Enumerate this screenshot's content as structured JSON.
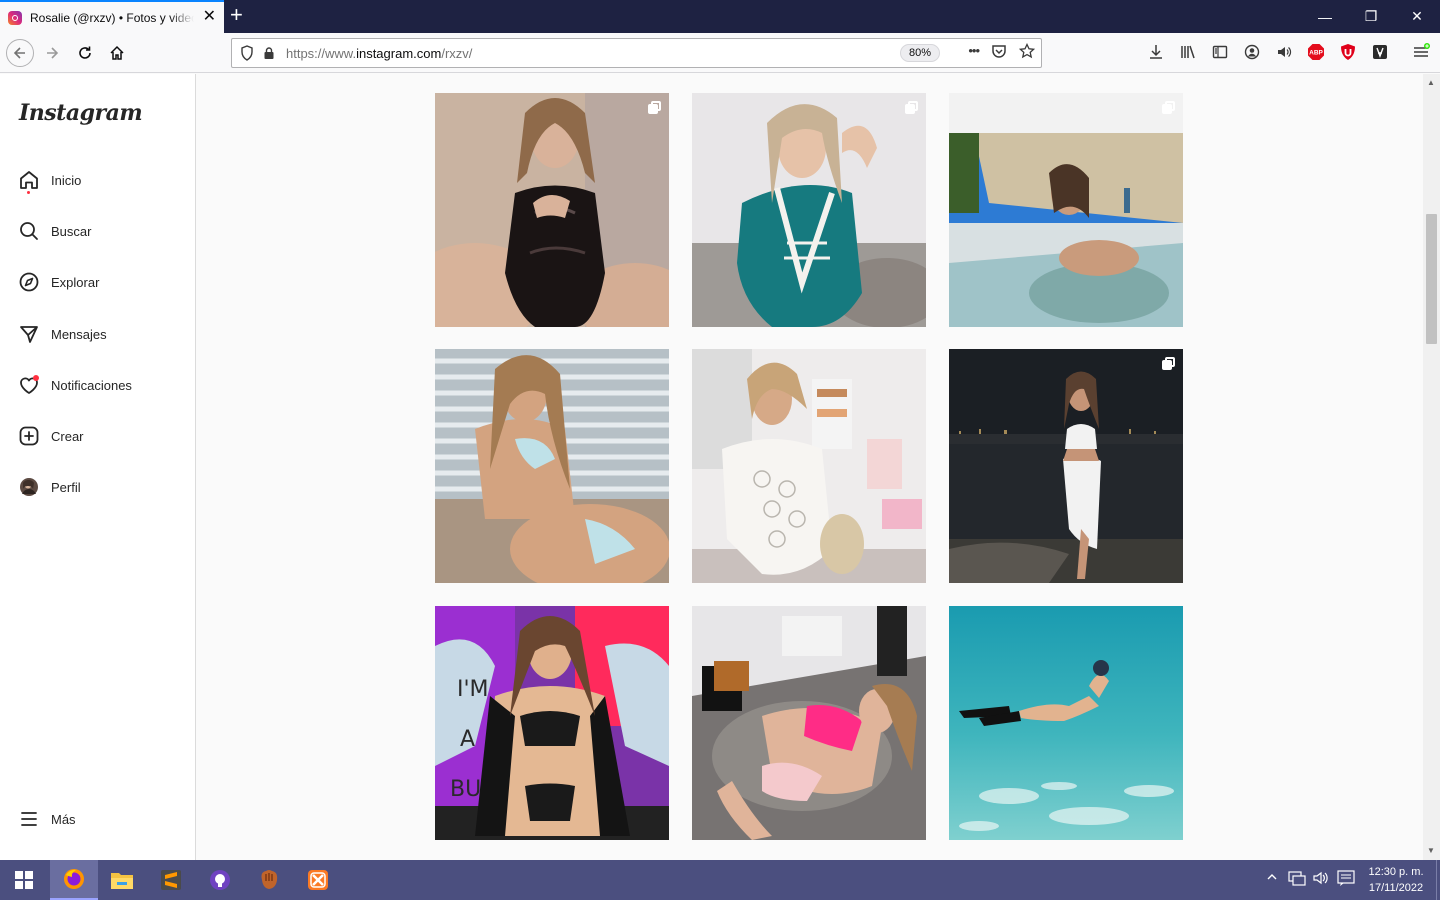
{
  "browser": {
    "tab_title": "Rosalie (@rxzv) • Fotos y videos de Instagram",
    "new_tab_label": "+",
    "url_prefix": "https://www.",
    "url_host": "instagram.com",
    "url_path": "/rxzv/",
    "zoom": "80%",
    "minimize": "—",
    "restore": "❐",
    "close": "✕",
    "page_actions": "•••",
    "close_tab": "✕"
  },
  "sidebar": {
    "logo": "Instagram",
    "items": [
      {
        "label": "Inicio",
        "icon": "home-icon"
      },
      {
        "label": "Buscar",
        "icon": "search-icon"
      },
      {
        "label": "Explorar",
        "icon": "compass-icon"
      },
      {
        "label": "Mensajes",
        "icon": "messenger-icon"
      },
      {
        "label": "Notificaciones",
        "icon": "heart-icon"
      },
      {
        "label": "Crear",
        "icon": "plus-square-icon"
      },
      {
        "label": "Perfil",
        "icon": "avatar"
      }
    ],
    "more_label": "Más"
  },
  "posts": [
    {
      "multi": true,
      "scene": "black vinyl corset, seated indoors"
    },
    {
      "multi": true,
      "scene": "teal satin lingerie with white lace"
    },
    {
      "multi": true,
      "scene": "hot tub on sunny terrace"
    },
    {
      "multi": false,
      "scene": "light blue bikini by window blinds"
    },
    {
      "multi": false,
      "scene": "white crochet top in bright room"
    },
    {
      "multi": true,
      "scene": "white outfit on beach at night"
    },
    {
      "multi": false,
      "scene": "black lace lingerie, colorful graffiti wall"
    },
    {
      "multi": false,
      "scene": "pink top lying on gray ottoman"
    },
    {
      "multi": false,
      "scene": "snorkeling underwater in turquoise sea"
    }
  ],
  "taskbar": {
    "clock_time": "12:30 p. m.",
    "clock_date": "17/11/2022",
    "apps": [
      "start-icon",
      "firefox-icon",
      "file-explorer-icon",
      "sublime-text-icon",
      "github-desktop-icon",
      "baseball-glove-icon",
      "xampp-icon"
    ]
  },
  "colors": {
    "firefox_tabbar": "#1e2242",
    "taskbar": "#4b4f7f",
    "notification_dot": "#ff3040"
  }
}
